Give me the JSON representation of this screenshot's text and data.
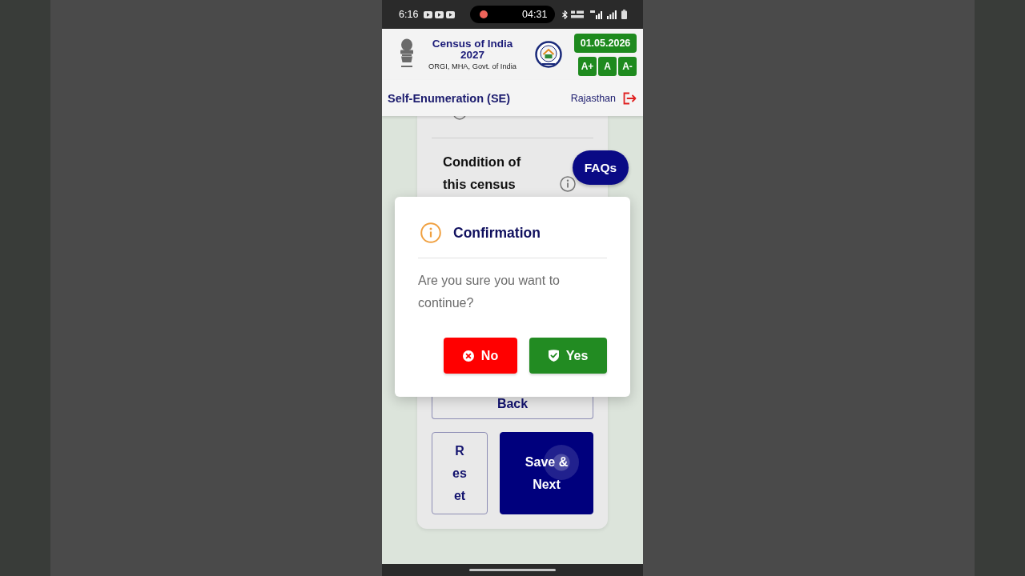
{
  "status_bar": {
    "time": "6:16",
    "recording_time": "04:31"
  },
  "header": {
    "title": "Census of India 2027",
    "subtitle": "ORGI, MHA, Govt. of India",
    "date": "01.05.2026",
    "text_size_buttons": [
      "A+",
      "A",
      "A-"
    ]
  },
  "subheader": {
    "title": "Self-Enumeration (SE)",
    "state": "Rajasthan"
  },
  "form": {
    "question": "Condition of this census",
    "button_rows": [
      [
        {
          "label": "Back",
          "kind": "outline"
        }
      ],
      [
        {
          "label": "Reset",
          "kind": "outline"
        },
        {
          "label": "Save & Next",
          "kind": "primary"
        }
      ]
    ]
  },
  "faq_button": "FAQs",
  "dialog": {
    "title": "Confirmation",
    "message": "Are you sure you want to continue?",
    "buttons": [
      {
        "label": "No",
        "kind": "cancel"
      },
      {
        "label": "Yes",
        "kind": "confirm"
      }
    ]
  }
}
